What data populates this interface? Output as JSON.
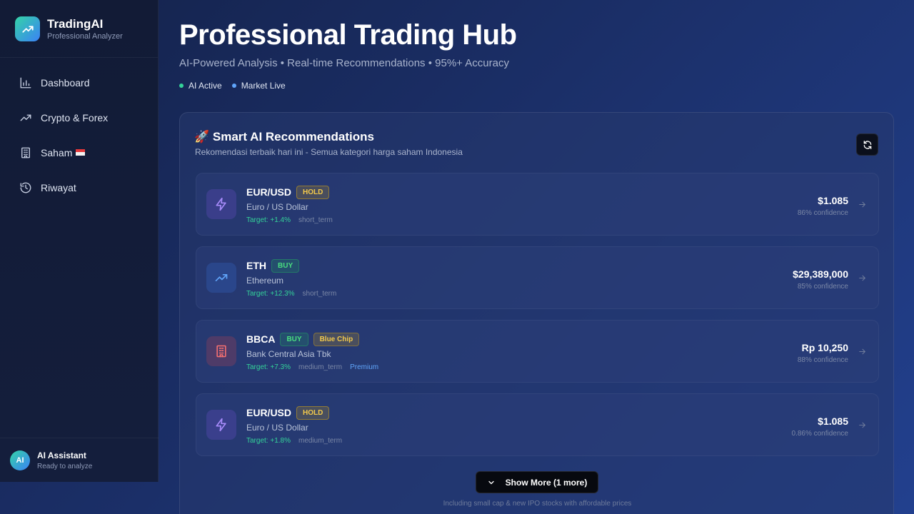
{
  "brand": {
    "name": "TradingAI",
    "tagline": "Professional Analyzer"
  },
  "sidebar": {
    "items": [
      {
        "label": "Dashboard",
        "icon": "bar-chart-icon"
      },
      {
        "label": "Crypto & Forex",
        "icon": "trending-up-icon"
      },
      {
        "label": "Saham",
        "icon": "building-icon",
        "flag": "indonesia-flag-icon"
      },
      {
        "label": "Riwayat",
        "icon": "history-icon"
      }
    ]
  },
  "assistant": {
    "avatar": "AI",
    "name": "AI Assistant",
    "status": "Ready to analyze"
  },
  "header": {
    "title": "Professional Trading Hub",
    "subtitle": "AI-Powered Analysis • Real-time Recommendations • 95%+ Accuracy",
    "statuses": [
      {
        "label": "AI Active",
        "color": "#34d399"
      },
      {
        "label": "Market Live",
        "color": "#60a5fa"
      }
    ]
  },
  "panel": {
    "title": "🚀 Smart AI Recommendations",
    "subtitle": "Rekomendasi terbaik hari ini - Semua kategori harga saham Indonesia",
    "refresh_icon": "refresh-icon",
    "show_more_label": "Show More (1 more)",
    "footnote": "Including small cap & new IPO stocks with affordable prices"
  },
  "recommendations": [
    {
      "symbol": "EUR/USD",
      "action": "HOLD",
      "name": "Euro / US Dollar",
      "target": "Target: +1.4%",
      "term": "short_term",
      "price": "$1.085",
      "confidence": "86% confidence",
      "icon": "lightning-icon"
    },
    {
      "symbol": "ETH",
      "action": "BUY",
      "name": "Ethereum",
      "target": "Target: +12.3%",
      "term": "short_term",
      "price": "$29,389,000",
      "confidence": "85% confidence",
      "icon": "trending-up-icon"
    },
    {
      "symbol": "BBCA",
      "action": "BUY",
      "tag": "Blue Chip",
      "name": "Bank Central Asia Tbk",
      "target": "Target: +7.3%",
      "term": "medium_term",
      "extra": "Premium",
      "price": "Rp 10,250",
      "confidence": "88% confidence",
      "icon": "building-icon"
    },
    {
      "symbol": "EUR/USD",
      "action": "HOLD",
      "name": "Euro / US Dollar",
      "target": "Target: +1.8%",
      "term": "medium_term",
      "price": "$1.085",
      "confidence": "0.86% confidence",
      "icon": "lightning-icon"
    }
  ],
  "colors": {
    "accent_green": "#34d399",
    "accent_blue": "#60a5fa",
    "hold": "#f2c94c",
    "buy": "#4ade80"
  }
}
